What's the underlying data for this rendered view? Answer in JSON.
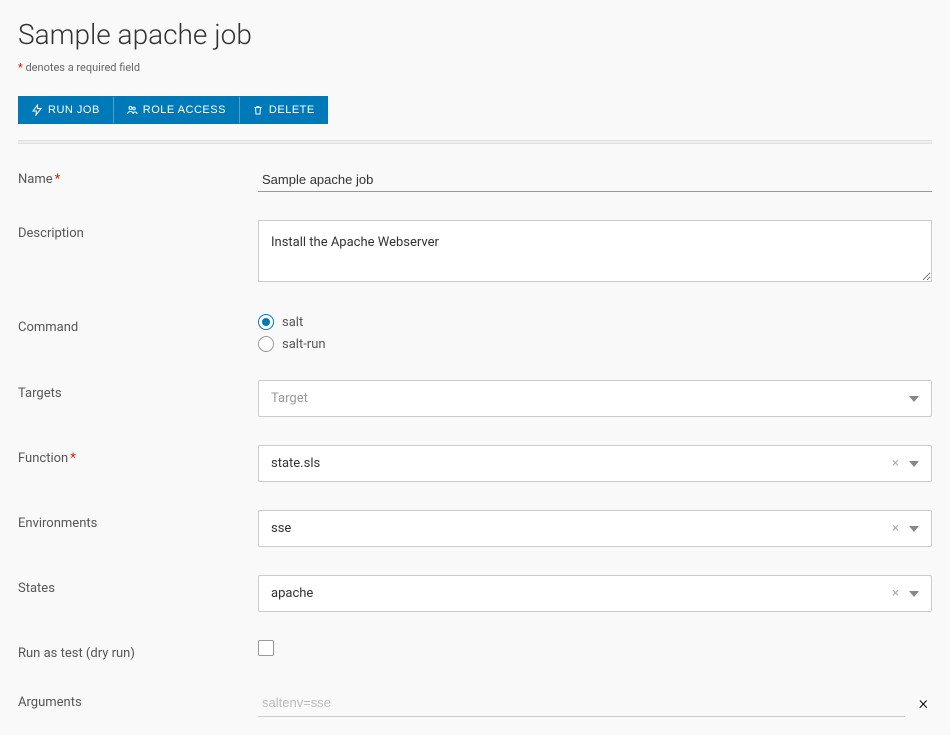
{
  "header": {
    "title": "Sample apache job",
    "required_note": "denotes a required field"
  },
  "toolbar": {
    "run_job_label": "RUN JOB",
    "role_access_label": "ROLE ACCESS",
    "delete_label": "DELETE"
  },
  "labels": {
    "name": "Name",
    "description": "Description",
    "command": "Command",
    "targets": "Targets",
    "function": "Function",
    "environments": "Environments",
    "states": "States",
    "run_as_test": "Run as test (dry run)",
    "arguments": "Arguments"
  },
  "form": {
    "name_value": "Sample apache job",
    "description_value": "Install the Apache Webserver",
    "command": {
      "option_salt": "salt",
      "option_salt_run": "salt-run",
      "selected": "salt"
    },
    "targets": {
      "placeholder": "Target",
      "value": ""
    },
    "function": {
      "value": "state.sls"
    },
    "environments": {
      "value": "sse"
    },
    "states": {
      "value": "apache"
    },
    "run_as_test": false,
    "arguments": [
      {
        "placeholder": "saltenv=sse",
        "value": ""
      }
    ]
  }
}
